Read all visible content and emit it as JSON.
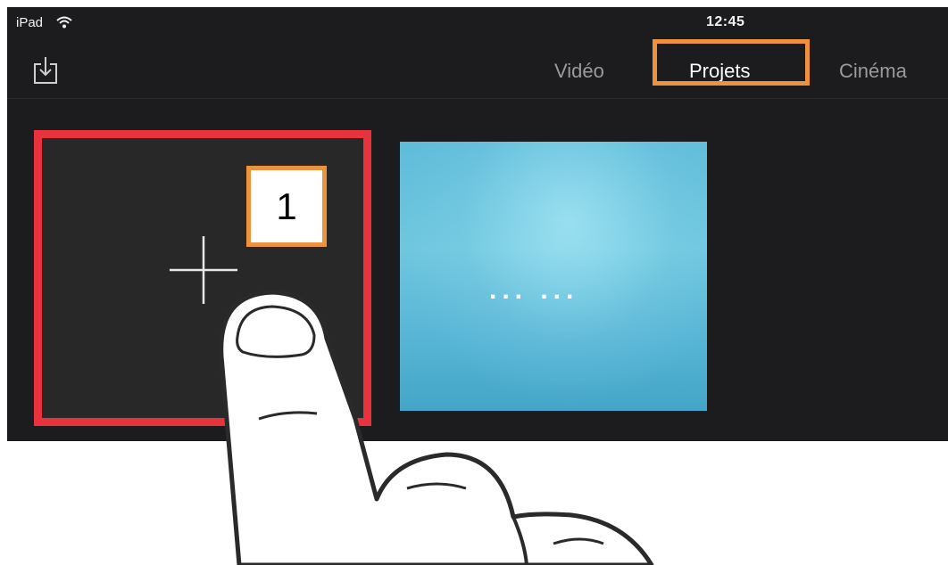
{
  "status_bar": {
    "device": "iPad",
    "time": "12:45",
    "wifi_icon": "wifi-icon"
  },
  "nav": {
    "import_icon": "import-icon",
    "tabs": [
      {
        "label": "Vidéo",
        "selected": false
      },
      {
        "label": "Projets",
        "selected": true
      },
      {
        "label": "Cinéma",
        "selected": false
      }
    ]
  },
  "projects": {
    "new_project_icon": "plus-icon",
    "loading_text": "... ...",
    "step_badge": "1"
  },
  "colors": {
    "screen_bg": "#1c1c1e",
    "tile_bg": "#282828",
    "highlight_orange": "#f0923b",
    "highlight_red": "#e8323c",
    "project_blue": "#5fbcd9"
  }
}
